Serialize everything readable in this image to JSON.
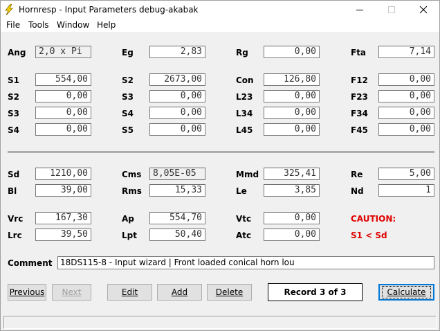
{
  "window": {
    "title": "Hornresp - Input Parameters   debug-akabak"
  },
  "menu": [
    "File",
    "Tools",
    "Window",
    "Help"
  ],
  "params": {
    "ang": {
      "label": "Ang",
      "value": "2,0 x Pi"
    },
    "eg": {
      "label": "Eg",
      "value": "2,83"
    },
    "rg": {
      "label": "Rg",
      "value": "0,00"
    },
    "fta": {
      "label": "Fta",
      "value": "7,14"
    },
    "s1": {
      "label": "S1",
      "value": "554,00"
    },
    "s2a": {
      "label": "S2",
      "value": "2673,00"
    },
    "con": {
      "label": "Con",
      "value": "126,80"
    },
    "f12": {
      "label": "F12",
      "value": "0,00"
    },
    "s2b": {
      "label": "S2",
      "value": "0,00"
    },
    "s3a": {
      "label": "S3",
      "value": "0,00"
    },
    "l23": {
      "label": "L23",
      "value": "0,00"
    },
    "f23": {
      "label": "F23",
      "value": "0,00"
    },
    "s3b": {
      "label": "S3",
      "value": "0,00"
    },
    "s4a": {
      "label": "S4",
      "value": "0,00"
    },
    "l34": {
      "label": "L34",
      "value": "0,00"
    },
    "f34": {
      "label": "F34",
      "value": "0,00"
    },
    "s4b": {
      "label": "S4",
      "value": "0,00"
    },
    "s5": {
      "label": "S5",
      "value": "0,00"
    },
    "l45": {
      "label": "L45",
      "value": "0,00"
    },
    "f45": {
      "label": "F45",
      "value": "0,00"
    },
    "sd": {
      "label": "Sd",
      "value": "1210,00"
    },
    "cms": {
      "label": "Cms",
      "value": "8,05E-05"
    },
    "mmd": {
      "label": "Mmd",
      "value": "325,41"
    },
    "re": {
      "label": "Re",
      "value": "5,00"
    },
    "bl": {
      "label": "Bl",
      "value": "39,00"
    },
    "rms": {
      "label": "Rms",
      "value": "15,33"
    },
    "le": {
      "label": "Le",
      "value": "3,85"
    },
    "nd": {
      "label": "Nd",
      "value": "1"
    },
    "vrc": {
      "label": "Vrc",
      "value": "167,30"
    },
    "ap": {
      "label": "Ap",
      "value": "554,70"
    },
    "vtc": {
      "label": "Vtc",
      "value": "0,00"
    },
    "lrc": {
      "label": "Lrc",
      "value": "39,50"
    },
    "lpt": {
      "label": "Lpt",
      "value": "50,40"
    },
    "atc": {
      "label": "Atc",
      "value": "0,00"
    }
  },
  "caution": {
    "title": "CAUTION:",
    "message": "S1 < Sd",
    "color": "#e00000"
  },
  "comment": {
    "label": "Comment",
    "value": "18DS115-8 - Input wizard | Front loaded conical horn lou"
  },
  "buttons": {
    "previous": "Previous",
    "next": "Next",
    "edit": "Edit",
    "add": "Add",
    "delete": "Delete",
    "calculate": "Calculate"
  },
  "record": "Record 3 of 3"
}
